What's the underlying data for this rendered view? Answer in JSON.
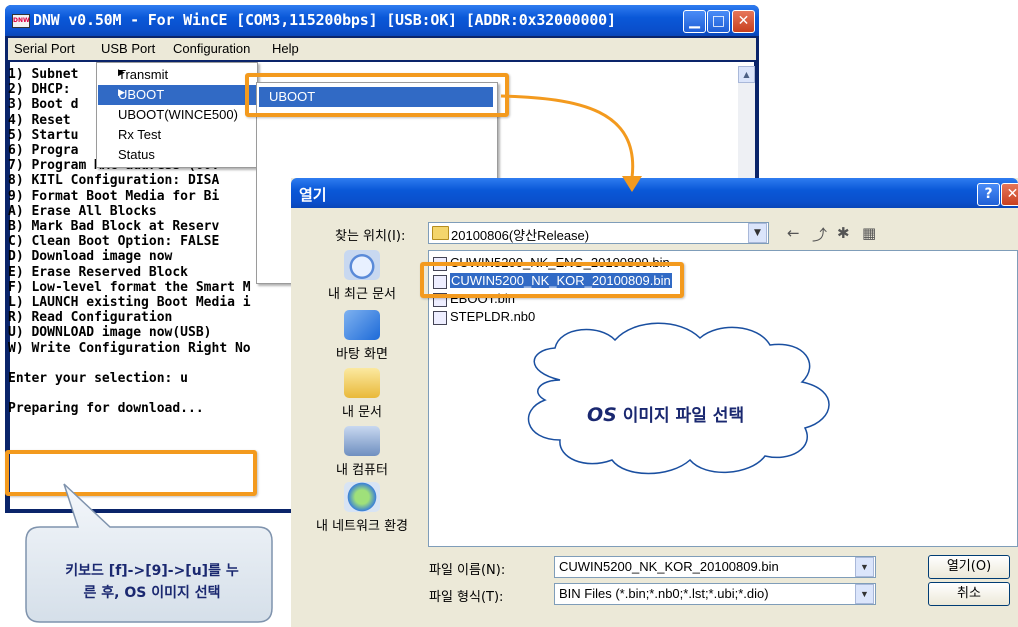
{
  "dnw": {
    "title": "DNW v0.50M - For WinCE    [COM3,115200bps] [USB:OK] [ADDR:0x32000000]",
    "icon_label": "DNW",
    "menu": [
      "Serial Port",
      "USB Port",
      "Configuration",
      "Help"
    ],
    "console_lines": [
      "1) Subnet",
      "2) DHCP:",
      "3) Boot d",
      "4) Reset",
      "5) Startu",
      "6) Progra",
      "7) Program MAC address (00:",
      "8) KITL Configuration: DISA",
      "9) Format Boot Media for Bi",
      "A) Erase All Blocks",
      "B) Mark Bad Block at Reserv",
      "C) Clean Boot Option: FALSE",
      "D) Download image now",
      "E) Erase Reserved Block",
      "F) Low-level format the Smart M",
      "L) LAUNCH existing Boot Media i",
      "R) Read Configuration",
      "U) DOWNLOAD image now(USB)",
      "W) Write Configuration Right No",
      "",
      "Enter your selection: u",
      "",
      "Preparing for download..."
    ]
  },
  "usb_menu": {
    "items": [
      "Transmit",
      "UBOOT",
      "UBOOT(WINCE500)",
      "Rx Test",
      "Status"
    ],
    "highlighted": "UBOOT",
    "submenu_item": "UBOOT"
  },
  "dialog": {
    "title": "열기",
    "help_btn": "?",
    "look_in_label": "찾는 위치(I):",
    "look_in_value": "20100806(양산Release)",
    "places": [
      "내 최근 문서",
      "바탕 화면",
      "내 문서",
      "내 컴퓨터",
      "내 네트워크 환경"
    ],
    "files": [
      "CUWIN5200_NK_ENG_20100809.bin",
      "CUWIN5200_NK_KOR_20100809.bin",
      "EBOOT.bin",
      "STEPLDR.nb0"
    ],
    "selected_file": "CUWIN5200_NK_KOR_20100809.bin",
    "filename_label": "파일 이름(N):",
    "filename_value": "CUWIN5200_NK_KOR_20100809.bin",
    "filetype_label": "파일 형식(T):",
    "filetype_value": "BIN Files (*.bin;*.nb0;*.lst;*.ubi;*.dio)",
    "open_btn": "열기(O)",
    "cancel_btn": "취소"
  },
  "annotations": {
    "cloud": {
      "bold": "OS",
      "rest": " 이미지 파일 선택"
    },
    "callout": [
      "키보드 [f]->[9]->[u]를 누",
      "른 후, OS 이미지 선택"
    ]
  },
  "colors": {
    "highlight": "#f39a1e",
    "selection": "#316ac5",
    "callout_text": "#1a2870"
  }
}
